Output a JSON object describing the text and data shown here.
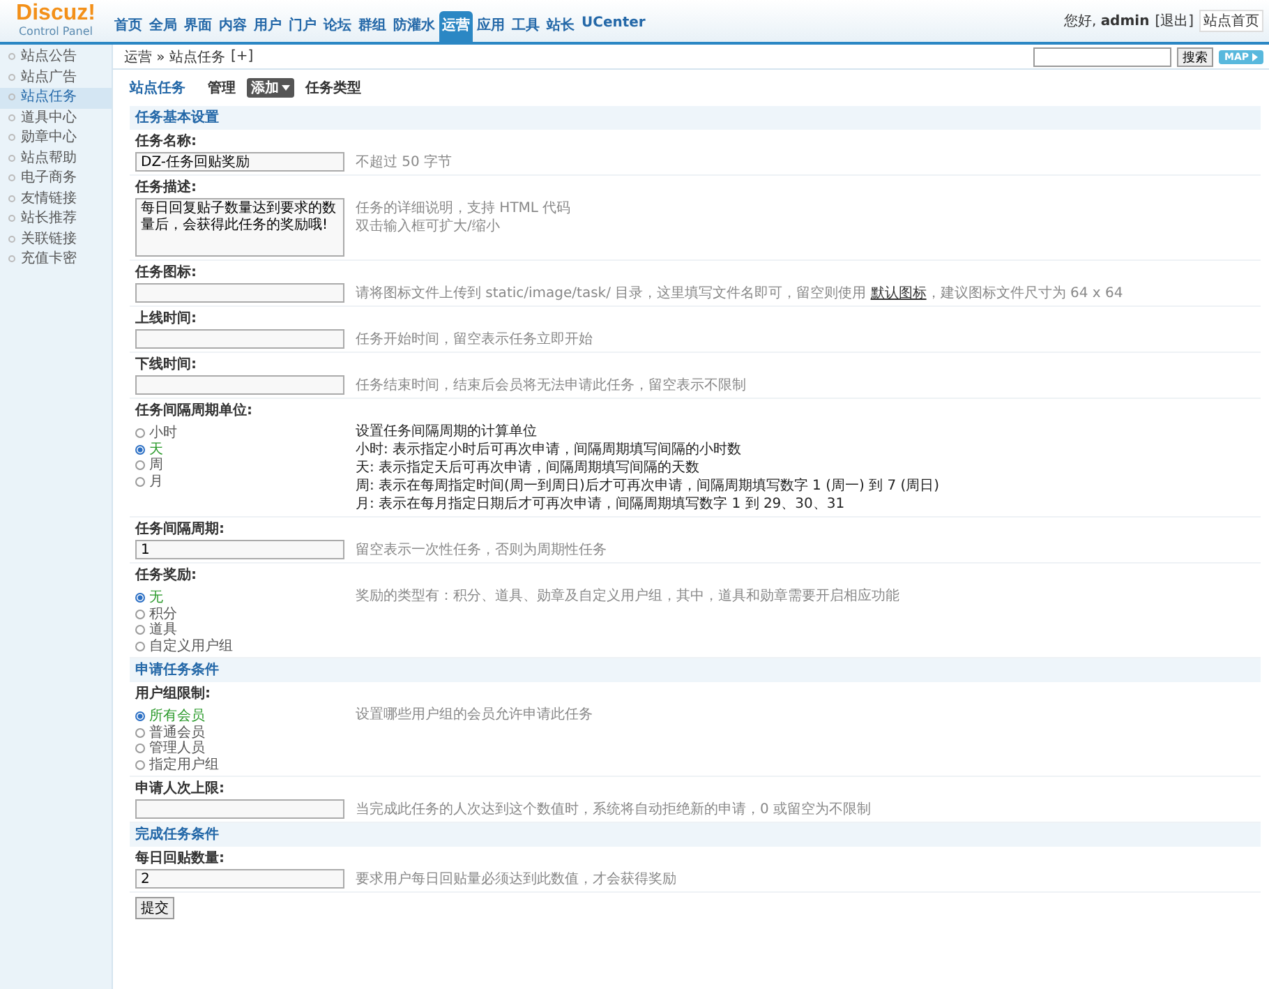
{
  "header": {
    "logo": "Discuz!",
    "subtitle": "Control Panel",
    "nav": [
      {
        "label": "首页",
        "selected": false
      },
      {
        "label": "全局",
        "selected": false
      },
      {
        "label": "界面",
        "selected": false
      },
      {
        "label": "内容",
        "selected": false
      },
      {
        "label": "用户",
        "selected": false
      },
      {
        "label": "门户",
        "selected": false
      },
      {
        "label": "论坛",
        "selected": false
      },
      {
        "label": "群组",
        "selected": false
      },
      {
        "label": "防灌水",
        "selected": false
      },
      {
        "label": "运营",
        "selected": true
      },
      {
        "label": "应用",
        "selected": false
      },
      {
        "label": "工具",
        "selected": false
      },
      {
        "label": "站长",
        "selected": false
      },
      {
        "label": "UCenter",
        "selected": false
      }
    ],
    "user": {
      "greeting": "您好,",
      "name": "admin",
      "logout": "[退出]",
      "home": "站点首页"
    }
  },
  "breadcrumb": {
    "parent": "运营",
    "separator": "»",
    "current": "站点任务",
    "add": "[+]"
  },
  "search": {
    "button": "搜索"
  },
  "map_button": "MAP",
  "sidebar": {
    "items": [
      {
        "label": "站点公告",
        "selected": false
      },
      {
        "label": "站点广告",
        "selected": false
      },
      {
        "label": "站点任务",
        "selected": true
      },
      {
        "label": "道具中心",
        "selected": false
      },
      {
        "label": "勋章中心",
        "selected": false
      },
      {
        "label": "站点帮助",
        "selected": false
      },
      {
        "label": "电子商务",
        "selected": false
      },
      {
        "label": "友情链接",
        "selected": false
      },
      {
        "label": "站长推荐",
        "selected": false
      },
      {
        "label": "关联链接",
        "selected": false
      },
      {
        "label": "充值卡密",
        "selected": false
      }
    ]
  },
  "subnav": {
    "title": "站点任务",
    "items": [
      {
        "label": "管理",
        "selected": false
      },
      {
        "label": "添加",
        "selected": true
      },
      {
        "label": "任务类型",
        "selected": false
      }
    ]
  },
  "sections": [
    {
      "title": "任务基本设置",
      "fields": [
        {
          "label": "任务名称:",
          "kind": "text",
          "value": "DZ-任务回贴奖励",
          "tips_dark": false,
          "tips": [
            {
              "text": "不超过 50 字节"
            }
          ]
        },
        {
          "label": "任务描述:",
          "kind": "textarea",
          "value": "每日回复贴子数量达到要求的数量后，会获得此任务的奖励哦!",
          "tips_dark": false,
          "tips": [
            {
              "text": "任务的详细说明，支持 HTML 代码"
            },
            {
              "text": "双击输入框可扩大/缩小"
            }
          ]
        },
        {
          "label": "任务图标:",
          "kind": "text",
          "tips_dark": false,
          "tips": [
            {
              "text": "请将图标文件上传到 static/image/task/ 目录，这里填写文件名即可，留空则使用 ",
              "link": "默认图标",
              "after": "，建议图标文件尺寸为 64 x 64"
            }
          ]
        },
        {
          "label": "上线时间:",
          "kind": "text",
          "tips_dark": false,
          "tips": [
            {
              "text": "任务开始时间，留空表示任务立即开始"
            }
          ]
        },
        {
          "label": "下线时间:",
          "kind": "text",
          "tips_dark": false,
          "tips": [
            {
              "text": "任务结束时间，结束后会员将无法申请此任务，留空表示不限制"
            }
          ]
        },
        {
          "label": "任务间隔周期单位:",
          "kind": "radio",
          "options": [
            {
              "label": "小时",
              "selected": false
            },
            {
              "label": "天",
              "selected": true
            },
            {
              "label": "周",
              "selected": false
            },
            {
              "label": "月",
              "selected": false
            }
          ],
          "tips_dark": true,
          "tips": [
            {
              "text": "设置任务间隔周期的计算单位"
            },
            {
              "text": "小时: 表示指定小时后可再次申请，间隔周期填写间隔的小时数"
            },
            {
              "text": "天: 表示指定天后可再次申请，间隔周期填写间隔的天数"
            },
            {
              "text": "周: 表示在每周指定时间(周一到周日)后才可再次申请，间隔周期填写数字 1 (周一) 到 7 (周日)"
            },
            {
              "text": "月: 表示在每月指定日期后才可再次申请，间隔周期填写数字 1 到 29、30、31"
            }
          ]
        },
        {
          "label": "任务间隔周期:",
          "kind": "text",
          "value": "1",
          "tips_dark": false,
          "tips": [
            {
              "text": "留空表示一次性任务，否则为周期性任务"
            }
          ]
        },
        {
          "label": "任务奖励:",
          "kind": "radio",
          "options": [
            {
              "label": "无",
              "selected": true
            },
            {
              "label": "积分",
              "selected": false
            },
            {
              "label": "道具",
              "selected": false
            },
            {
              "label": "自定义用户组",
              "selected": false
            }
          ],
          "tips_dark": false,
          "tips": [
            {
              "text": "奖励的类型有：积分、道具、勋章及自定义用户组，其中，道具和勋章需要开启相应功能"
            }
          ]
        }
      ]
    },
    {
      "title": "申请任务条件",
      "fields": [
        {
          "label": "用户组限制:",
          "kind": "radio",
          "options": [
            {
              "label": "所有会员",
              "selected": true
            },
            {
              "label": "普通会员",
              "selected": false
            },
            {
              "label": "管理人员",
              "selected": false
            },
            {
              "label": "指定用户组",
              "selected": false
            }
          ],
          "tips_dark": false,
          "tips": [
            {
              "text": "设置哪些用户组的会员允许申请此任务"
            }
          ]
        },
        {
          "label": "申请人次上限:",
          "kind": "text",
          "tips_dark": false,
          "tips": [
            {
              "text": "当完成此任务的人次达到这个数值时，系统将自动拒绝新的申请，0 或留空为不限制"
            }
          ]
        }
      ]
    },
    {
      "title": "完成任务条件",
      "fields": [
        {
          "label": "每日回贴数量:",
          "kind": "text",
          "value": "2",
          "tips_dark": false,
          "tips": [
            {
              "text": "要求用户每日回贴量必须达到此数值，才会获得奖励"
            }
          ]
        }
      ]
    }
  ],
  "submit": "提交"
}
